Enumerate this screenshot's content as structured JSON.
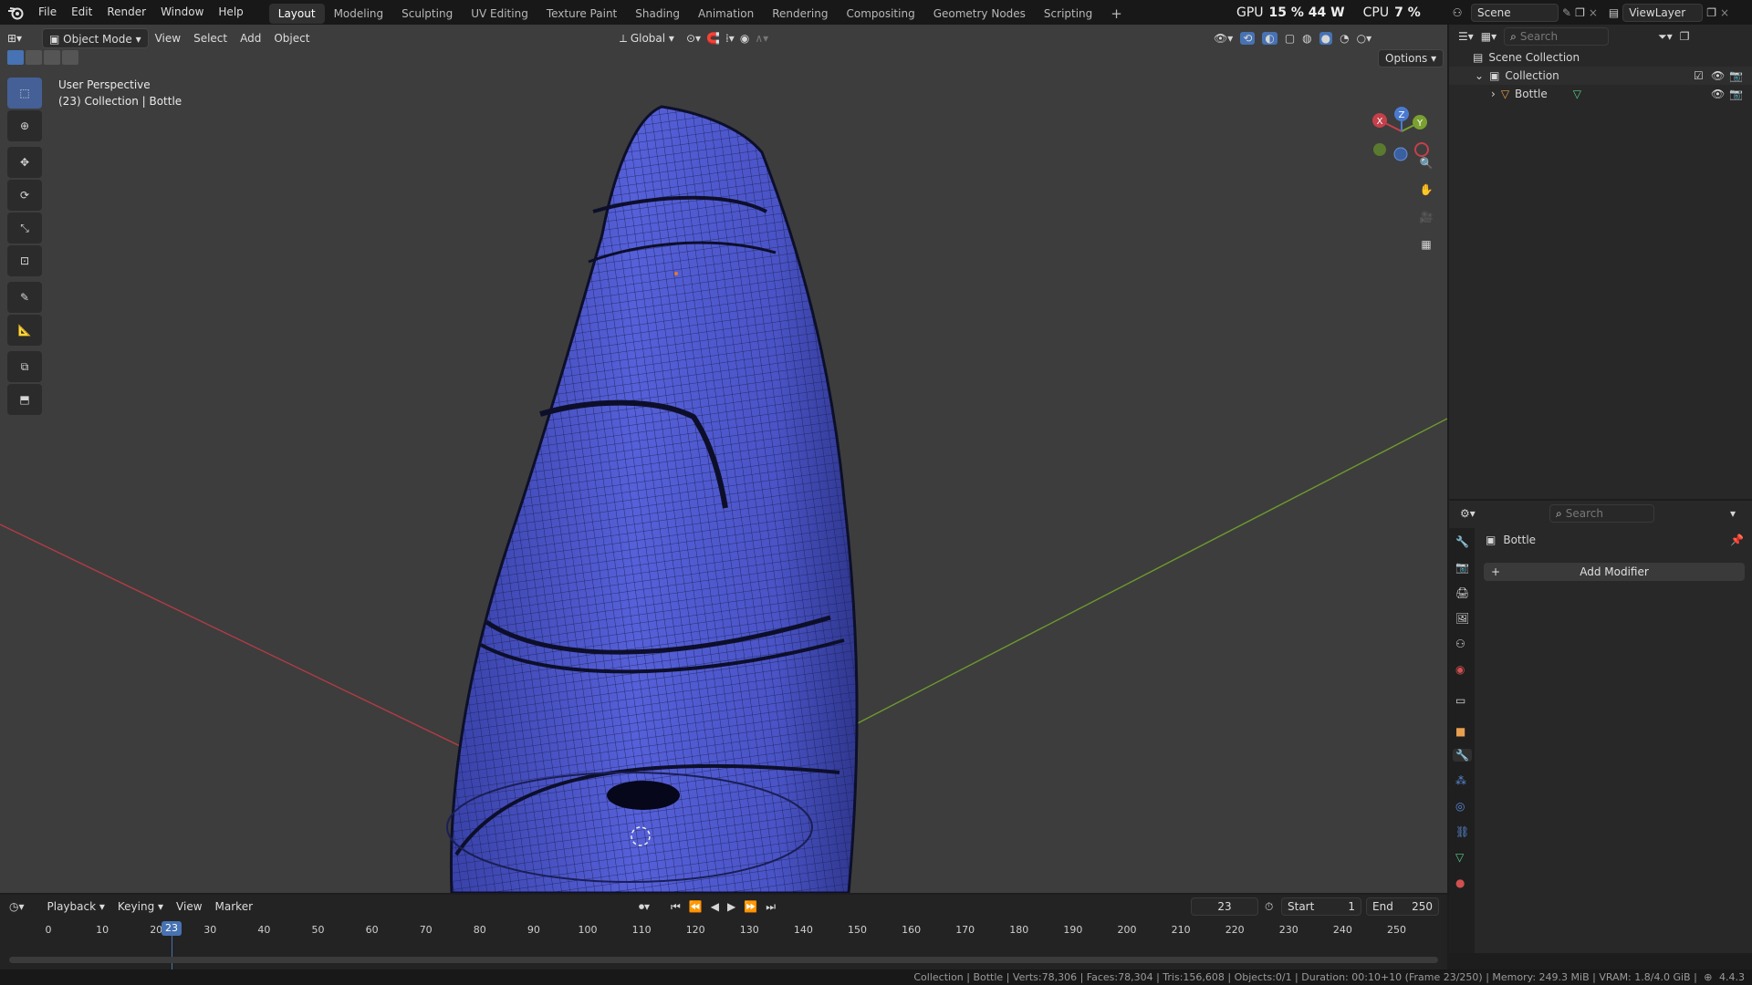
{
  "topbar": {
    "menus": [
      "File",
      "Edit",
      "Render",
      "Window",
      "Help"
    ],
    "workspaces": [
      "Layout",
      "Modeling",
      "Sculpting",
      "UV Editing",
      "Texture Paint",
      "Shading",
      "Animation",
      "Rendering",
      "Compositing",
      "Geometry Nodes",
      "Scripting"
    ],
    "active_workspace": "Layout",
    "plus": "+",
    "gpu_label": "GPU",
    "gpu_value": "15 % 44 W",
    "cpu_label": "CPU",
    "cpu_value": "7 %",
    "scene": "Scene",
    "view_layer": "ViewLayer"
  },
  "viewport": {
    "mode": "Object Mode",
    "menus": [
      "View",
      "Select",
      "Add",
      "Object"
    ],
    "transform_orientation": "Global",
    "options": "Options",
    "perspective": "User Perspective",
    "collection_info": "(23) Collection | Bottle",
    "gizmo": {
      "x": "X",
      "y": "Y",
      "z": "Z"
    }
  },
  "outliner": {
    "search_placeholder": "Search",
    "scene_collection": "Scene Collection",
    "collection": "Collection",
    "object": "Bottle"
  },
  "properties": {
    "search_placeholder": "Search",
    "object_name": "Bottle",
    "add_modifier": "Add Modifier"
  },
  "timeline": {
    "menus": [
      "Playback",
      "Keying",
      "View",
      "Marker"
    ],
    "current_frame": "23",
    "start_label": "Start",
    "start": "1",
    "end_label": "End",
    "end": "250",
    "ticks": [
      "0",
      "10",
      "20",
      "30",
      "40",
      "50",
      "60",
      "70",
      "80",
      "90",
      "100",
      "110",
      "120",
      "130",
      "140",
      "150",
      "160",
      "170",
      "180",
      "190",
      "200",
      "210",
      "220",
      "230",
      "240",
      "250"
    ],
    "playhead": "23"
  },
  "status": {
    "text": "Collection | Bottle | Verts:78,306 | Faces:78,304 | Tris:156,608 | Objects:0/1 | Duration: 00:10+10 (Frame 23/250) | Memory: 249.3 MiB | VRAM: 1.8/4.0 GiB |",
    "version": "4.4.3"
  },
  "colors": {
    "accent": "#4772b3",
    "mesh": "#4a55c8",
    "x_axis": "#c4404a",
    "y_axis": "#7aa030"
  }
}
